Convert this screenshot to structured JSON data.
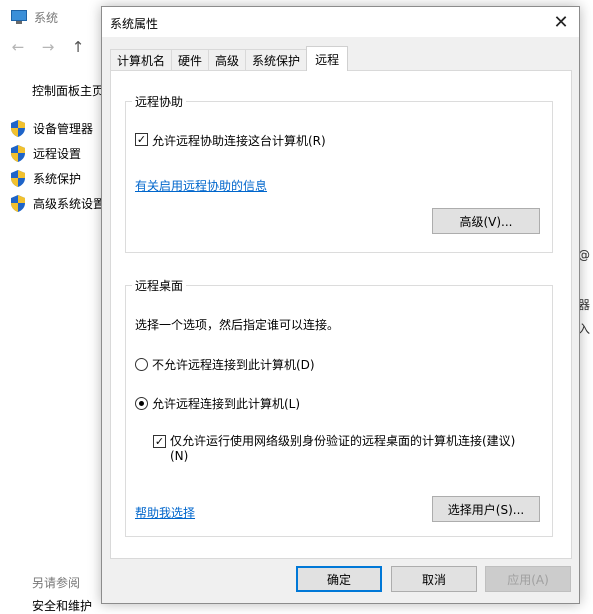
{
  "background": {
    "window_title": "系统",
    "nav": {
      "back": "←",
      "forward": "→",
      "up": "↑"
    },
    "control_panel_home": "控制面板主页",
    "side_links": [
      {
        "label": "设备管理器"
      },
      {
        "label": "远程设置"
      },
      {
        "label": "系统保护"
      },
      {
        "label": "高级系统设置"
      }
    ],
    "see_also": "另请参阅",
    "security": "安全和维护",
    "right_fragments": [
      "@",
      "器",
      "入"
    ]
  },
  "dialog": {
    "title": "系统属性",
    "close": "✕",
    "tabs": [
      {
        "label": "计算机名"
      },
      {
        "label": "硬件"
      },
      {
        "label": "高级"
      },
      {
        "label": "系统保护"
      },
      {
        "label": "远程",
        "active": true
      }
    ],
    "remote_assistance": {
      "title": "远程协助",
      "allow_checkbox": {
        "label": "允许远程协助连接这台计算机(R)",
        "checked": true
      },
      "info_link": "有关启用远程协助的信息",
      "advanced_button": "高级(V)..."
    },
    "remote_desktop": {
      "title": "远程桌面",
      "description": "选择一个选项，然后指定谁可以连接。",
      "option_deny": {
        "label": "不允许远程连接到此计算机(D)",
        "selected": false
      },
      "option_allow": {
        "label": "允许远程连接到此计算机(L)",
        "selected": true
      },
      "nla_checkbox": {
        "label_line1": "仅允许运行使用网络级别身份验证的远程桌面的计算机连接(建议)",
        "label_line2": "(N)",
        "checked": true
      },
      "help_link": "帮助我选择",
      "select_users_button": "选择用户(S)..."
    },
    "buttons": {
      "ok": "确定",
      "cancel": "取消",
      "apply": "应用(A)"
    },
    "check_mark": "✓"
  }
}
